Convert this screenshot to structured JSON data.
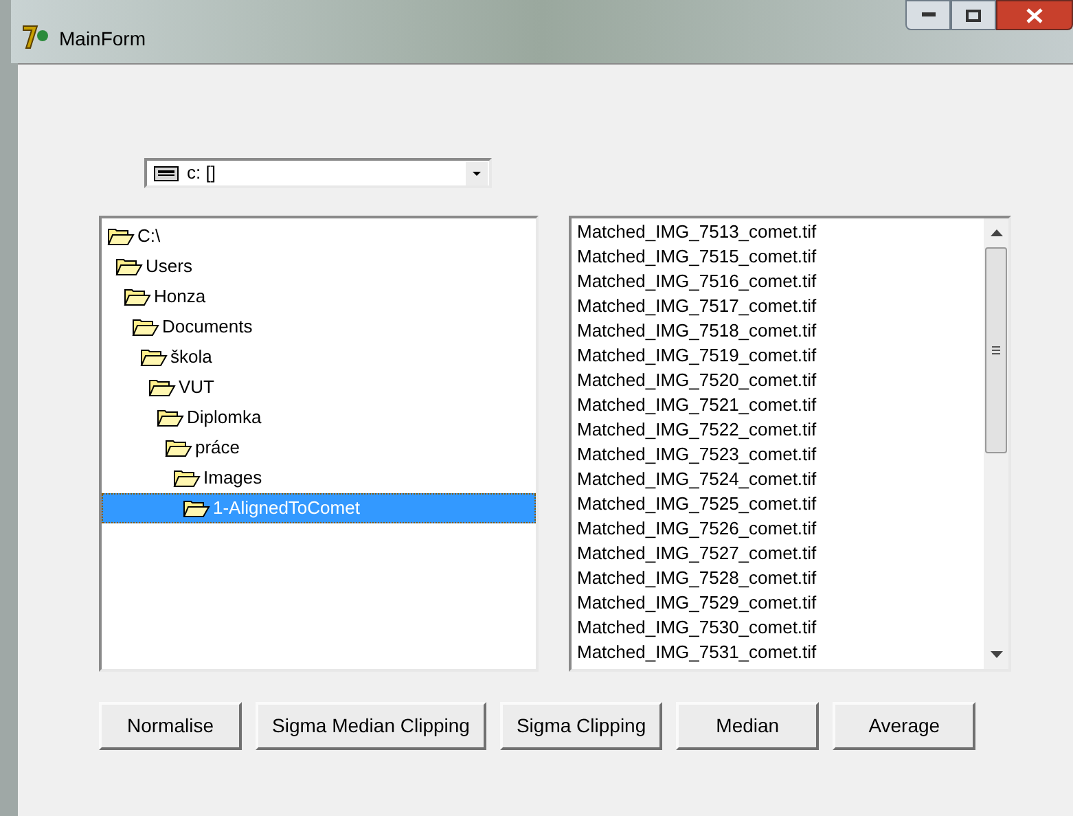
{
  "window": {
    "title": "MainForm"
  },
  "drive_combo": {
    "value": "c: []"
  },
  "folder_tree": [
    {
      "label": "C:\\",
      "selected": false,
      "children": [
        {
          "label": "Users",
          "selected": false,
          "children": [
            {
              "label": "Honza",
              "selected": false,
              "children": [
                {
                  "label": "Documents",
                  "selected": false,
                  "children": [
                    {
                      "label": "škola",
                      "selected": false,
                      "children": [
                        {
                          "label": "VUT",
                          "selected": false,
                          "children": [
                            {
                              "label": "Diplomka",
                              "selected": false,
                              "children": [
                                {
                                  "label": "práce",
                                  "selected": false,
                                  "children": [
                                    {
                                      "label": "Images",
                                      "selected": false,
                                      "children": [
                                        {
                                          "label": "1-AlignedToComet",
                                          "selected": true
                                        }
                                      ]
                                    }
                                  ]
                                }
                              ]
                            }
                          ]
                        }
                      ]
                    }
                  ]
                }
              ]
            }
          ]
        }
      ]
    }
  ],
  "file_list": [
    "Matched_IMG_7513_comet.tif",
    "Matched_IMG_7515_comet.tif",
    "Matched_IMG_7516_comet.tif",
    "Matched_IMG_7517_comet.tif",
    "Matched_IMG_7518_comet.tif",
    "Matched_IMG_7519_comet.tif",
    "Matched_IMG_7520_comet.tif",
    "Matched_IMG_7521_comet.tif",
    "Matched_IMG_7522_comet.tif",
    "Matched_IMG_7523_comet.tif",
    "Matched_IMG_7524_comet.tif",
    "Matched_IMG_7525_comet.tif",
    "Matched_IMG_7526_comet.tif",
    "Matched_IMG_7527_comet.tif",
    "Matched_IMG_7528_comet.tif",
    "Matched_IMG_7529_comet.tif",
    "Matched_IMG_7530_comet.tif",
    "Matched_IMG_7531_comet.tif"
  ],
  "buttons": [
    "Normalise",
    "Sigma Median Clipping",
    "Sigma Clipping",
    "Median",
    "Average"
  ]
}
